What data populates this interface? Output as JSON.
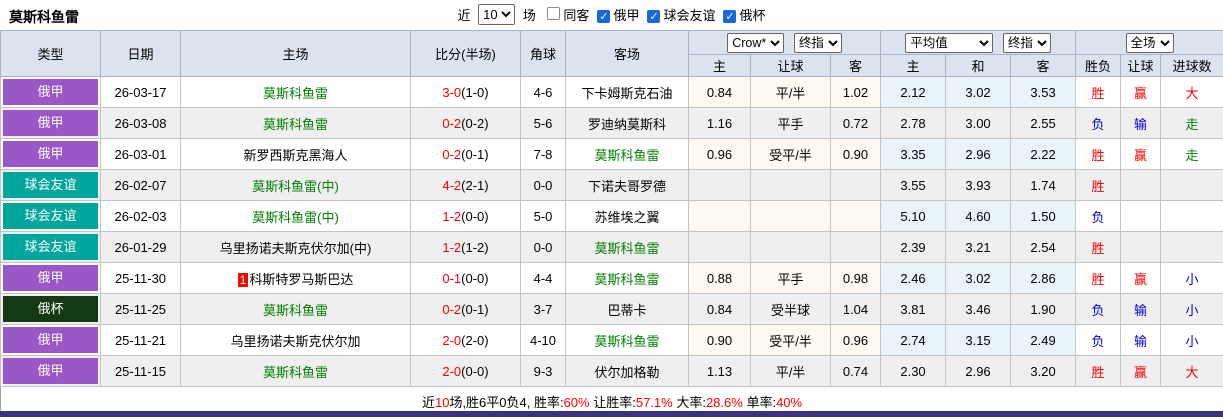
{
  "page": {
    "title": "莫斯科鱼雷"
  },
  "topbar": {
    "recent_label": "近",
    "recent_value": "10",
    "matches_label": "场",
    "checkboxes": [
      {
        "label": "同客",
        "checked": false
      },
      {
        "label": "俄甲",
        "checked": true
      },
      {
        "label": "球会友谊",
        "checked": true
      },
      {
        "label": "俄杯",
        "checked": true
      }
    ]
  },
  "table": {
    "col_headers": [
      "类型",
      "日期",
      "主场",
      "比分(半场)",
      "角球",
      "客场"
    ],
    "sub_headers": [
      "主",
      "让球",
      "客",
      "主",
      "和",
      "客",
      "胜负",
      "让球",
      "进球数"
    ],
    "selects": {
      "odds_source": "Crow*",
      "odds_stage": "终指",
      "avg_source": "平均值",
      "avg_stage": "终指",
      "scope": "全场"
    },
    "league_colors": {
      "俄甲": "#9a57c8",
      "球会友谊": "#00a69c",
      "俄杯": "#143a14"
    },
    "rows": [
      {
        "league": "俄甲",
        "lc": "purple",
        "date": "26-03-17",
        "home": "莫斯科鱼雷",
        "hg": true,
        "badge": "",
        "ft": "3-0",
        "ht": "(1-0)",
        "corner": "4-6",
        "away": "下卡姆斯克石油",
        "ag": false,
        "crow": [
          "0.84",
          "平/半",
          "1.02"
        ],
        "avg": [
          "2.12",
          "3.02",
          "3.53"
        ],
        "res": [
          "胜",
          "赢",
          "大"
        ],
        "resc": [
          "red",
          "red",
          "red"
        ]
      },
      {
        "league": "俄甲",
        "lc": "purple",
        "date": "26-03-08",
        "home": "莫斯科鱼雷",
        "hg": true,
        "badge": "",
        "ft": "0-2",
        "ht": "(0-2)",
        "corner": "5-6",
        "away": "罗迪纳莫斯科",
        "ag": false,
        "crow": [
          "1.16",
          "平手",
          "0.72"
        ],
        "avg": [
          "2.78",
          "3.00",
          "2.55"
        ],
        "res": [
          "负",
          "输",
          "走"
        ],
        "resc": [
          "blue",
          "blue",
          "green"
        ]
      },
      {
        "league": "俄甲",
        "lc": "purple",
        "date": "26-03-01",
        "home": "新罗西斯克黑海人",
        "hg": false,
        "badge": "",
        "ft": "0-2",
        "ht": "(0-1)",
        "corner": "7-8",
        "away": "莫斯科鱼雷",
        "ag": true,
        "crow": [
          "0.96",
          "受平/半",
          "0.90"
        ],
        "avg": [
          "3.35",
          "2.96",
          "2.22"
        ],
        "res": [
          "胜",
          "赢",
          "走"
        ],
        "resc": [
          "red",
          "red",
          "green"
        ]
      },
      {
        "league": "球会友谊",
        "lc": "teal",
        "date": "26-02-07",
        "home": "莫斯科鱼雷(中)",
        "hg": true,
        "badge": "",
        "ft": "4-2",
        "ht": "(2-1)",
        "corner": "0-0",
        "away": "下诺夫哥罗德",
        "ag": false,
        "crow": [
          "",
          "",
          ""
        ],
        "avg": [
          "3.55",
          "3.93",
          "1.74"
        ],
        "res": [
          "胜",
          "",
          ""
        ],
        "resc": [
          "red",
          "black",
          "black"
        ]
      },
      {
        "league": "球会友谊",
        "lc": "teal",
        "date": "26-02-03",
        "home": "莫斯科鱼雷(中)",
        "hg": true,
        "badge": "",
        "ft": "1-2",
        "ht": "(0-0)",
        "corner": "5-0",
        "away": "苏维埃之翼",
        "ag": false,
        "crow": [
          "",
          "",
          ""
        ],
        "avg": [
          "5.10",
          "4.60",
          "1.50"
        ],
        "res": [
          "负",
          "",
          ""
        ],
        "resc": [
          "blue",
          "black",
          "black"
        ]
      },
      {
        "league": "球会友谊",
        "lc": "teal",
        "date": "26-01-29",
        "home": "乌里扬诺夫斯克伏尔加(中)",
        "hg": false,
        "badge": "",
        "ft": "1-2",
        "ht": "(1-2)",
        "corner": "0-0",
        "away": "莫斯科鱼雷",
        "ag": true,
        "crow": [
          "",
          "",
          ""
        ],
        "avg": [
          "2.39",
          "3.21",
          "2.54"
        ],
        "res": [
          "胜",
          "",
          ""
        ],
        "resc": [
          "red",
          "black",
          "black"
        ]
      },
      {
        "league": "俄甲",
        "lc": "purple",
        "date": "25-11-30",
        "home": "科斯特罗马斯巴达",
        "hg": false,
        "badge": "1",
        "ft": "0-1",
        "ht": "(0-0)",
        "corner": "4-4",
        "away": "莫斯科鱼雷",
        "ag": true,
        "crow": [
          "0.88",
          "平手",
          "0.98"
        ],
        "avg": [
          "2.46",
          "3.02",
          "2.86"
        ],
        "res": [
          "胜",
          "赢",
          "小"
        ],
        "resc": [
          "red",
          "red",
          "blue"
        ]
      },
      {
        "league": "俄杯",
        "lc": "dgreen",
        "date": "25-11-25",
        "home": "莫斯科鱼雷",
        "hg": true,
        "badge": "",
        "ft": "0-2",
        "ht": "(0-1)",
        "corner": "3-7",
        "away": "巴蒂卡",
        "ag": false,
        "crow": [
          "0.84",
          "受半球",
          "1.04"
        ],
        "avg": [
          "3.81",
          "3.46",
          "1.90"
        ],
        "res": [
          "负",
          "输",
          "小"
        ],
        "resc": [
          "blue",
          "blue",
          "blue"
        ]
      },
      {
        "league": "俄甲",
        "lc": "purple",
        "date": "25-11-21",
        "home": "乌里扬诺夫斯克伏尔加",
        "hg": false,
        "badge": "",
        "ft": "2-0",
        "ht": "(2-0)",
        "corner": "4-10",
        "away": "莫斯科鱼雷",
        "ag": true,
        "crow": [
          "0.90",
          "受平/半",
          "0.96"
        ],
        "avg": [
          "2.74",
          "3.15",
          "2.49"
        ],
        "res": [
          "负",
          "输",
          "小"
        ],
        "resc": [
          "blue",
          "blue",
          "blue"
        ]
      },
      {
        "league": "俄甲",
        "lc": "purple",
        "date": "25-11-15",
        "home": "莫斯科鱼雷",
        "hg": true,
        "badge": "",
        "ft": "2-0",
        "ht": "(0-0)",
        "corner": "9-3",
        "away": "伏尔加格勒",
        "ag": false,
        "crow": [
          "1.13",
          "平/半",
          "0.74"
        ],
        "avg": [
          "2.30",
          "2.96",
          "3.20"
        ],
        "res": [
          "胜",
          "赢",
          "大"
        ],
        "resc": [
          "red",
          "red",
          "red"
        ]
      }
    ]
  },
  "summary": {
    "segments": [
      {
        "t": "近",
        "c": "black"
      },
      {
        "t": "10",
        "c": "red"
      },
      {
        "t": "场,胜6平0负4, 胜率:",
        "c": "black"
      },
      {
        "t": "60%",
        "c": "red"
      },
      {
        "t": " 让胜率:",
        "c": "black"
      },
      {
        "t": "57.1%",
        "c": "red"
      },
      {
        "t": " 大率:",
        "c": "black"
      },
      {
        "t": "28.6%",
        "c": "red"
      },
      {
        "t": " 单率:",
        "c": "black"
      },
      {
        "t": "40%",
        "c": "red"
      }
    ]
  },
  "colors": {
    "accent_bar": "#3a3183",
    "header_bg": "#dce3f0",
    "stripe": "#efefef",
    "crow_col_bg": "#fdf8f0",
    "avg_col_bg": "#e8f3fa",
    "win_red": "#ff0000",
    "lose_blue": "#0000dd",
    "team_green": "#008000",
    "checkbox_blue": "#1668dc"
  }
}
